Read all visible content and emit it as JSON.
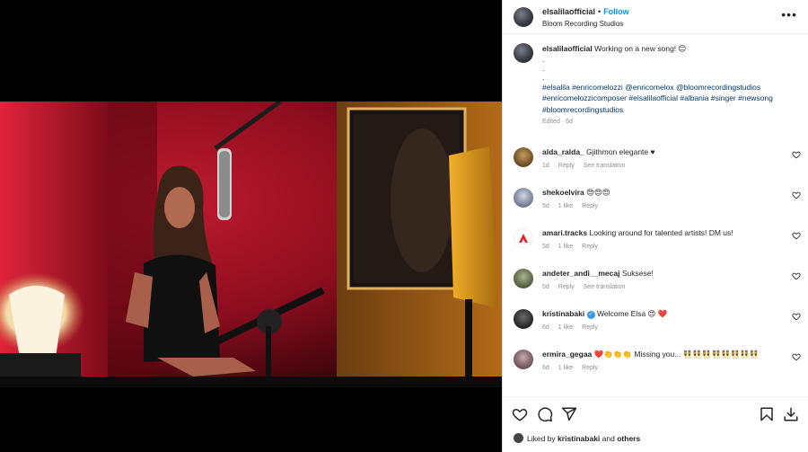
{
  "post": {
    "username": "elsalilaofficial",
    "separator": "•",
    "follow_label": "Follow",
    "location": "Bloom Recording Studios",
    "more_label": "•••"
  },
  "caption": {
    "username": "elsalilaofficial",
    "text": "Working on a new song! 😊",
    "dots": [
      ".",
      ".",
      "."
    ],
    "hashtags": "#elsalila #enricomelozzi @enricomelox @bloomrecordingstudios #enricomelozzicomposer #elsalilaofficial #albania #singer #newsong #bloomrecordingstudios",
    "meta": "Edited · 6d"
  },
  "comments": [
    {
      "user": "alda_ralda_",
      "text": "Gjithmon elegante ♥",
      "time": "1d",
      "likes": "",
      "reply": "Reply",
      "translation": "See translation",
      "avatar_color": "#7a5a2c"
    },
    {
      "user": "shekoelvira",
      "text": "😍😍😍",
      "time": "5d",
      "likes": "1 like",
      "reply": "Reply",
      "translation": "",
      "avatar_color": "#8b93a6"
    },
    {
      "user": "amari.tracks",
      "text": "Looking around for talented artists! DM us!",
      "time": "5d",
      "likes": "1 like",
      "reply": "Reply",
      "translation": "",
      "avatar_color": "#ffffff"
    },
    {
      "user": "andeter_andi__mecaj",
      "text": "Suksese!",
      "time": "5d",
      "likes": "",
      "reply": "Reply",
      "translation": "See translation",
      "avatar_color": "#6b7a5a"
    },
    {
      "user": "kristinabaki",
      "verified": "✓",
      "text": "Welcome Elsa 😍 ❤️",
      "time": "6d",
      "likes": "1 like",
      "reply": "Reply",
      "translation": "",
      "avatar_color": "#3a3a3a"
    },
    {
      "user": "ermira_gegaa",
      "text": "❤️👏👏👏 Missing you... 👯👯👯👯👯👯👯👯",
      "time": "6d",
      "likes": "1 like",
      "reply": "Reply",
      "translation": "",
      "avatar_color": "#9a7f86"
    }
  ],
  "likes": {
    "prefix": "Liked by",
    "user": "kristinabaki",
    "conj": "and",
    "others": "others"
  },
  "icons": [
    "heart-icon",
    "comment-icon",
    "share-icon",
    "bookmark-icon",
    "download-icon",
    "more-icon",
    "verified-icon"
  ],
  "colors": {
    "link": "#00376b",
    "follow": "#0095f6",
    "verified": "#3897f0",
    "muted": "#8e8e8e"
  }
}
